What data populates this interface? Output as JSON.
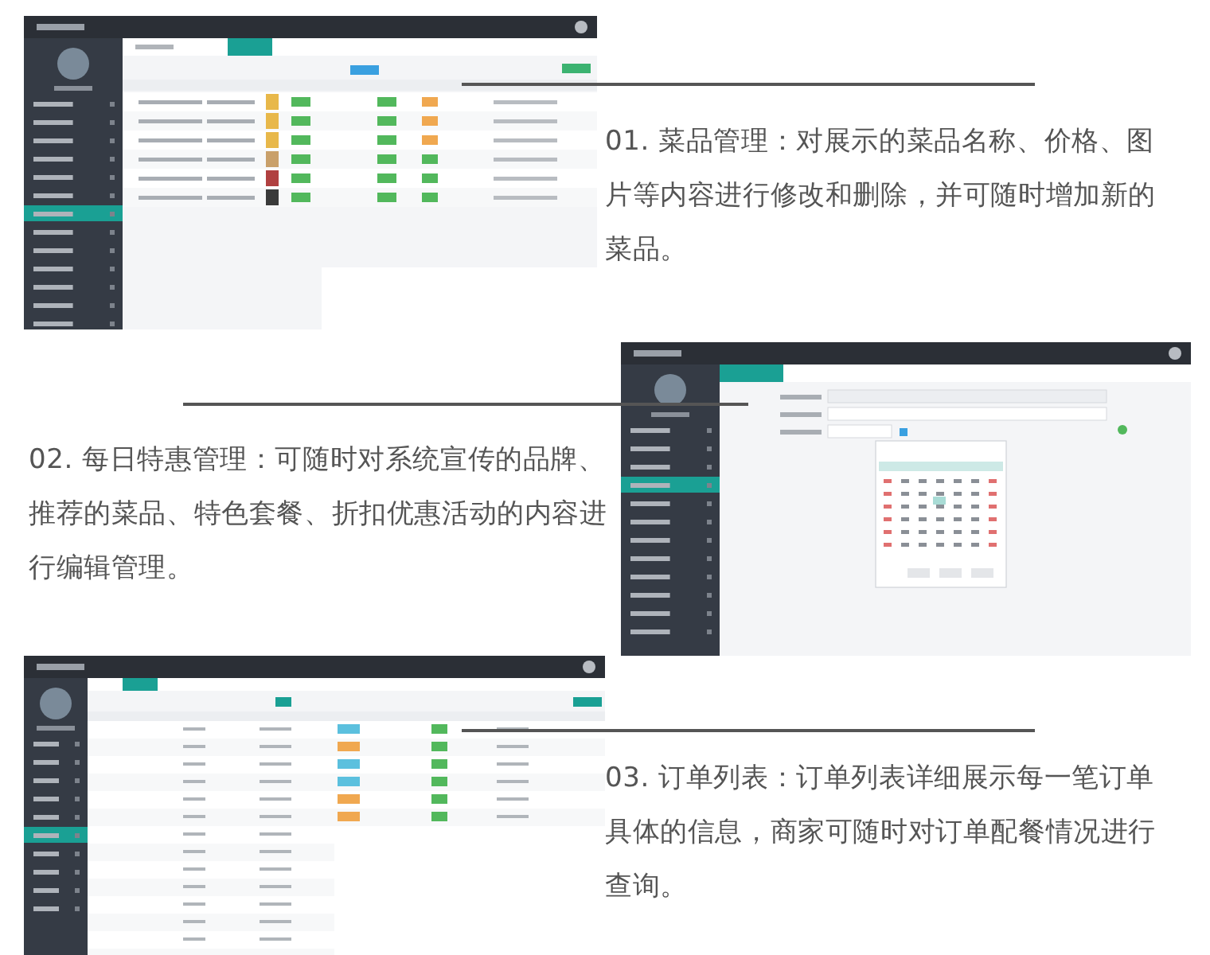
{
  "sections": [
    {
      "kind": "menu-table",
      "image_on_right": false,
      "text": "01. 菜品管理：对展示的菜品名称、价格、图片等内容进行修改和删除，并可随时增加新的菜品。"
    },
    {
      "kind": "date-form",
      "image_on_right": true,
      "text": "02. 每日特惠管理：可随时对系统宣传的品牌、推荐的菜品、特色套餐、折扣优惠活动的内容进行编辑管理。"
    },
    {
      "kind": "order-table",
      "image_on_right": false,
      "text": "03. 订单列表：订单列表详细展示每一笔订单具体的信息，商家可随时对订单配餐情况进行查询。"
    }
  ]
}
